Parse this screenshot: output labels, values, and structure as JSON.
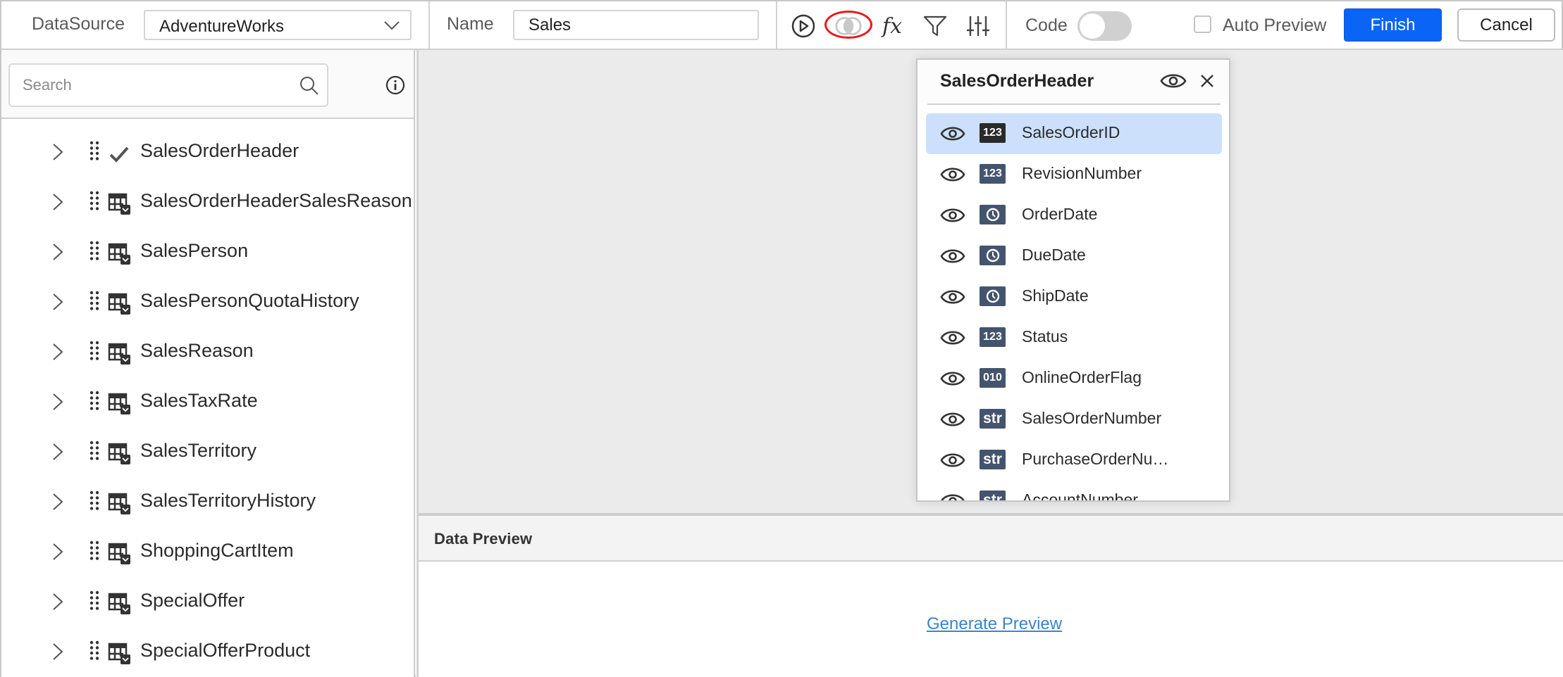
{
  "toolbar": {
    "datasource_label": "DataSource",
    "datasource_value": "AdventureWorks",
    "name_label": "Name",
    "name_value": "Sales",
    "code_label": "Code",
    "code_enabled": false,
    "auto_preview_label": "Auto Preview",
    "auto_preview_checked": false,
    "finish_label": "Finish",
    "cancel_label": "Cancel",
    "icons": [
      "play-icon",
      "join-icon",
      "expression-icon",
      "filter-icon",
      "parameters-icon"
    ],
    "highlight_color": "#e81a1a",
    "accent_color": "#0a64f5"
  },
  "left_panel": {
    "search_placeholder": "Search",
    "tables": [
      {
        "name": "SalesOrderHeader",
        "selected": true
      },
      {
        "name": "SalesOrderHeaderSalesReason",
        "selected": false
      },
      {
        "name": "SalesPerson",
        "selected": false
      },
      {
        "name": "SalesPersonQuotaHistory",
        "selected": false
      },
      {
        "name": "SalesReason",
        "selected": false
      },
      {
        "name": "SalesTaxRate",
        "selected": false
      },
      {
        "name": "SalesTerritory",
        "selected": false
      },
      {
        "name": "SalesTerritoryHistory",
        "selected": false
      },
      {
        "name": "ShoppingCartItem",
        "selected": false
      },
      {
        "name": "SpecialOffer",
        "selected": false
      },
      {
        "name": "SpecialOfferProduct",
        "selected": false
      }
    ]
  },
  "table_popup": {
    "title": "SalesOrderHeader",
    "fields": [
      {
        "name": "SalesOrderID",
        "type": "123",
        "kind": "number",
        "selected": true
      },
      {
        "name": "RevisionNumber",
        "type": "123",
        "kind": "number",
        "selected": false
      },
      {
        "name": "OrderDate",
        "type": "clock",
        "kind": "date",
        "selected": false
      },
      {
        "name": "DueDate",
        "type": "clock",
        "kind": "date",
        "selected": false
      },
      {
        "name": "ShipDate",
        "type": "clock",
        "kind": "date",
        "selected": false
      },
      {
        "name": "Status",
        "type": "123",
        "kind": "number",
        "selected": false
      },
      {
        "name": "OnlineOrderFlag",
        "type": "010",
        "kind": "boolean",
        "selected": false
      },
      {
        "name": "SalesOrderNumber",
        "type": "str",
        "kind": "string",
        "selected": false
      },
      {
        "name": "PurchaseOrderNu…",
        "type": "str",
        "kind": "string",
        "selected": false
      },
      {
        "name": "AccountNumber",
        "type": "str",
        "kind": "string",
        "selected": false
      }
    ]
  },
  "data_preview": {
    "title": "Data Preview",
    "generate_link": "Generate Preview",
    "link_color": "#3a84cc"
  }
}
